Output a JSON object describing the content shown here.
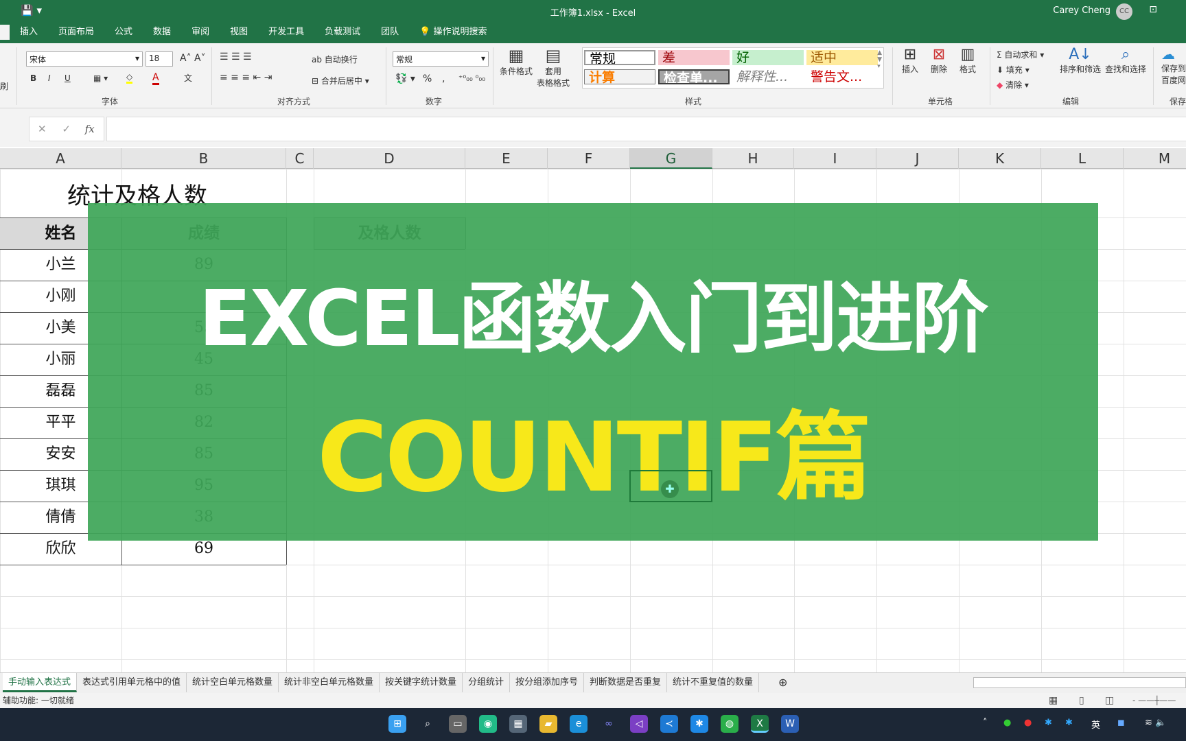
{
  "window": {
    "title": "工作簿1.xlsx  -  Excel",
    "user": "Carey Cheng",
    "avatar": "CC"
  },
  "menu_tabs": [
    "插入",
    "页面布局",
    "公式",
    "数据",
    "审阅",
    "视图",
    "开发工具",
    "负载测试",
    "团队",
    "操作说明搜索"
  ],
  "ribbon": {
    "font_name": "宋体",
    "font_size": "18",
    "font_group": "字体",
    "wrap_text": "自动换行",
    "merge_center": "合并后居中",
    "align_group": "对齐方式",
    "number_format": "常规",
    "number_group": "数字",
    "cond_format": "条件格式",
    "table_format_1": "套用",
    "table_format_2": "表格格式",
    "styles": [
      "常规",
      "差",
      "好",
      "适中",
      "计算",
      "检查单...",
      "解释性...",
      "警告文..."
    ],
    "styles_group": "样式",
    "insert": "插入",
    "delete": "删除",
    "format": "格式",
    "cells_group": "单元格",
    "autosum": "自动求和",
    "fill": "填充",
    "clear": "清除",
    "sort_filter": "排序和筛选",
    "find_select": "查找和选择",
    "edit_group": "编辑",
    "save_baidu_1": "保存到",
    "save_baidu_2": "百度网盘",
    "save_group": "保存",
    "format_painter": "刷",
    "bold": "B",
    "italic": "I",
    "underline": "U",
    "percent": "%",
    "comma": ","
  },
  "formula_bar": {
    "fx": "fx",
    "value": ""
  },
  "columns": [
    "A",
    "B",
    "C",
    "D",
    "E",
    "F",
    "G",
    "H",
    "I",
    "J",
    "K",
    "L",
    "M"
  ],
  "sheet": {
    "title": "统计及格人数",
    "headers": [
      "姓名",
      "成绩",
      "及格人数"
    ],
    "rows": [
      [
        "小兰",
        "89"
      ],
      [
        "小刚",
        ""
      ],
      [
        "小美",
        "55"
      ],
      [
        "小丽",
        "45"
      ],
      [
        "磊磊",
        "85"
      ],
      [
        "平平",
        "82"
      ],
      [
        "安安",
        "85"
      ],
      [
        "琪琪",
        "95"
      ],
      [
        "倩倩",
        "38"
      ],
      [
        "欣欣",
        "69"
      ]
    ]
  },
  "overlay": {
    "line1": "EXCEL函数入门到进阶",
    "line2": "COUNTIF篇",
    "accent": "#3ea658",
    "yellow": "#f7e81a"
  },
  "sheet_tabs": [
    "手动输入表达式",
    "表达式引用单元格中的值",
    "统计空白单元格数量",
    "统计非空白单元格数量",
    "按关键字统计数量",
    "分组统计",
    "按分组添加序号",
    "判断数据是否重复",
    "统计不重复值的数量"
  ],
  "status": "辅助功能: 一切就绪",
  "tray": {
    "ime": "英"
  }
}
